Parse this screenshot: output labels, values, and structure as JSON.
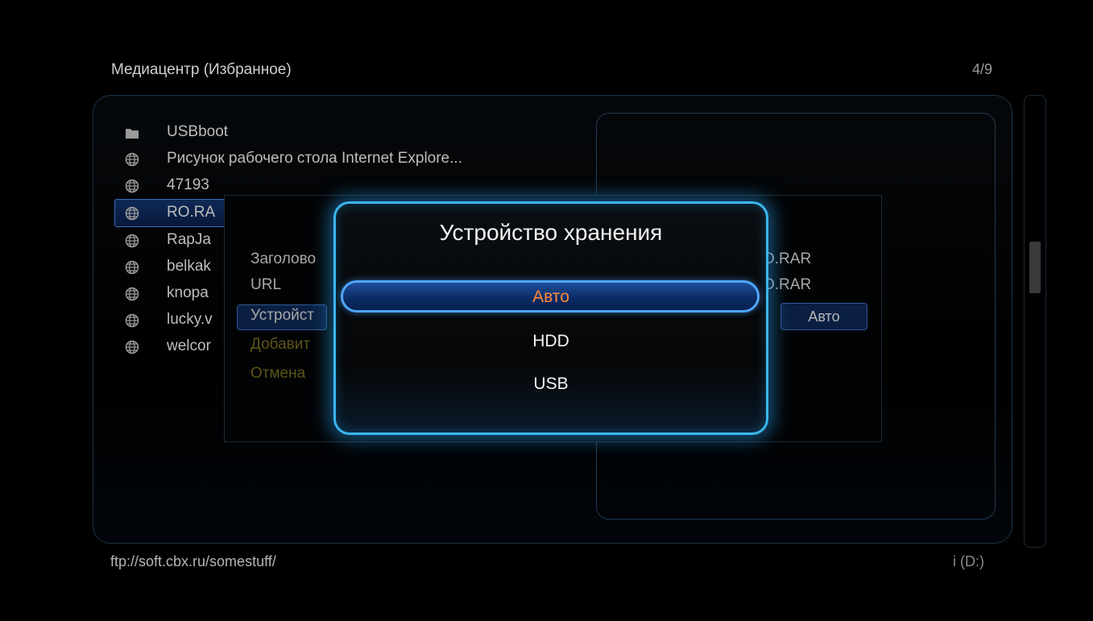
{
  "header": {
    "title": "Медиацентр (Избранное)",
    "page_count": "4/9"
  },
  "list": {
    "items": [
      {
        "icon": "folder-icon",
        "label": "USBboot"
      },
      {
        "icon": "globe-icon",
        "label": "Рисунок рабочего стола Internet Explore..."
      },
      {
        "icon": "globe-icon",
        "label": "47193"
      },
      {
        "icon": "globe-icon",
        "label": "RO.RA"
      },
      {
        "icon": "globe-icon",
        "label": "RapJa"
      },
      {
        "icon": "globe-icon",
        "label": "belkak"
      },
      {
        "icon": "globe-icon",
        "label": "knopa"
      },
      {
        "icon": "globe-icon",
        "label": "lucky.v"
      },
      {
        "icon": "globe-icon",
        "label": "welcor"
      }
    ]
  },
  "properties": {
    "labels": [
      "Заголово",
      "URL",
      "Устройст",
      "Добавит",
      "Отмена"
    ],
    "values": [
      "O.RAR",
      "O.RAR",
      "Авто"
    ]
  },
  "modal": {
    "title": "Устройство хранения",
    "options": [
      "Авто",
      "HDD",
      "USB"
    ],
    "selected": "Авто"
  },
  "status": {
    "path": "ftp://soft.cbx.ru/somestuff/",
    "drive": "i (D:)"
  },
  "colors": {
    "accent": "#3ab7ee",
    "selected_text": "#ff8a3a",
    "disabled_text": "#5c5418"
  }
}
